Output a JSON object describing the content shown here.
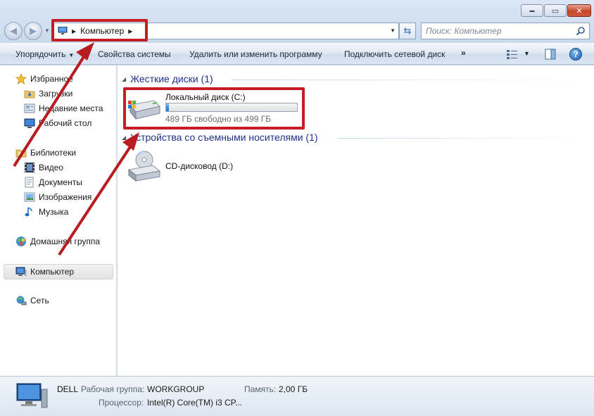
{
  "window": {
    "caption": {
      "minimize": "▬",
      "maximize": "▭",
      "close": "✕"
    }
  },
  "nav": {
    "back_icon": "back-arrow-icon",
    "forward_icon": "forward-arrow-icon",
    "address": {
      "crumbs": [
        "Компьютер"
      ]
    },
    "search": {
      "placeholder": "Поиск: Компьютер",
      "value": ""
    }
  },
  "toolbar": {
    "organize": "Упорядочить",
    "system_properties": "Свойства системы",
    "uninstall": "Удалить или изменить программу",
    "map_drive": "Подключить сетевой диск",
    "more": "»",
    "help": "?"
  },
  "sidebar": {
    "favorites": {
      "label": "Избранное",
      "items": [
        {
          "label": "Загрузки",
          "icon": "downloads-folder-icon"
        },
        {
          "label": "Недавние места",
          "icon": "recent-places-icon"
        },
        {
          "label": "Рабочий стол",
          "icon": "desktop-icon"
        }
      ]
    },
    "libraries": {
      "label": "Библиотеки",
      "items": [
        {
          "label": "Видео",
          "icon": "video-library-icon"
        },
        {
          "label": "Документы",
          "icon": "documents-library-icon"
        },
        {
          "label": "Изображения",
          "icon": "pictures-library-icon"
        },
        {
          "label": "Музыка",
          "icon": "music-library-icon"
        }
      ]
    },
    "homegroup": "Домашняя группа",
    "computer": "Компьютер",
    "network": "Сеть"
  },
  "content": {
    "hard_drives": {
      "header": "Жесткие диски (1)",
      "drive": {
        "name": "Локальный диск (C:)",
        "free_text": "489 ГБ свободно из 499 ГБ",
        "used_fraction": 0.02
      }
    },
    "removable": {
      "header": "Устройства со съемными носителями (1)",
      "drive": {
        "name": "CD-дисковод (D:)"
      }
    }
  },
  "details": {
    "computer_name": "DELL",
    "workgroup_label": "Рабочая группа:",
    "workgroup_value": "WORKGROUP",
    "memory_label": "Память:",
    "memory_value": "2,00 ГБ",
    "processor_label": "Процессор:",
    "processor_value": "Intel(R) Core(TM) i3 CP..."
  },
  "colors": {
    "highlight_red": "#c41d25",
    "group_header": "#1e3287",
    "usage_fill": "#2a8be0"
  }
}
